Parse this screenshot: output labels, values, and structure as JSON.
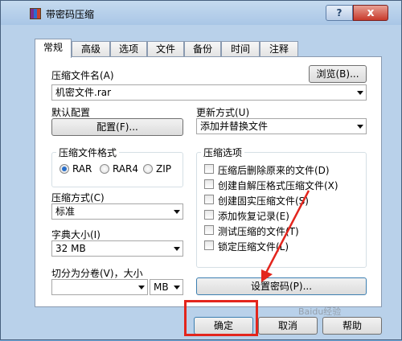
{
  "window": {
    "title": "带密码压缩",
    "help_label": "?",
    "close_label": "x"
  },
  "tabs": [
    {
      "label": "常规",
      "active": true
    },
    {
      "label": "高级"
    },
    {
      "label": "选项"
    },
    {
      "label": "文件"
    },
    {
      "label": "备份"
    },
    {
      "label": "时间"
    },
    {
      "label": "注释"
    }
  ],
  "archive_name": {
    "label": "压缩文件名(A)",
    "value": "机密文件.rar",
    "browse_label": "浏览(B)..."
  },
  "profile": {
    "label": "默认配置",
    "button_label": "配置(F)..."
  },
  "update_mode": {
    "label": "更新方式(U)",
    "value": "添加并替换文件"
  },
  "format": {
    "title": "压缩文件格式",
    "options": [
      "RAR",
      "RAR4",
      "ZIP"
    ],
    "selected": "RAR"
  },
  "method": {
    "label": "压缩方式(C)",
    "value": "标准"
  },
  "dictionary": {
    "label": "字典大小(I)",
    "value": "32 MB"
  },
  "split": {
    "label": "切分为分卷(V)，大小",
    "value": "",
    "unit": "MB"
  },
  "options": {
    "title": "压缩选项",
    "items": [
      {
        "label": "压缩后删除原来的文件(D)",
        "checked": false
      },
      {
        "label": "创建自解压格式压缩文件(X)",
        "checked": false
      },
      {
        "label": "创建固实压缩文件(S)",
        "checked": false
      },
      {
        "label": "添加恢复记录(E)",
        "checked": false
      },
      {
        "label": "测试压缩的文件(T)",
        "checked": false
      },
      {
        "label": "锁定压缩文件(L)",
        "checked": false
      }
    ]
  },
  "set_password_label": "设置密码(P)...",
  "footer": {
    "ok_label": "确定",
    "cancel_label": "取消",
    "help_label": "帮助"
  },
  "watermark": "Baidu经验",
  "colors": {
    "annotation_red": "#e3251d",
    "title_gradient_top": "#c5daef",
    "close_red": "#c83a2c"
  }
}
